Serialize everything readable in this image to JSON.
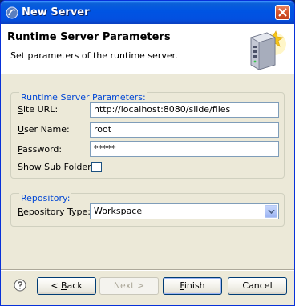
{
  "window": {
    "title": "New Server"
  },
  "header": {
    "title": "Runtime Server Parameters",
    "description": "Set parameters of the runtime server."
  },
  "params_group": {
    "legend": "Runtime Server Parameters:",
    "site_url": {
      "label_accel": "S",
      "label_rest": "ite URL:",
      "value": "http://localhost:8080/slide/files"
    },
    "user_name": {
      "label_pre": "",
      "label_accel": "U",
      "label_rest": "ser Name:",
      "value": "root"
    },
    "password": {
      "label_accel": "P",
      "label_rest": "assword:",
      "value": "*****"
    },
    "show_sub_folders": {
      "label_pre": "Sho",
      "label_accel": "w",
      "label_rest": " Sub Folders",
      "checked": false
    }
  },
  "repository_group": {
    "legend": "Repository:",
    "repo_type": {
      "label_accel": "R",
      "label_rest": "epository Type:",
      "value": "Workspace"
    }
  },
  "buttons": {
    "back_pre": "< ",
    "back_accel": "B",
    "back_rest": "ack",
    "next": "Next >",
    "finish_accel": "F",
    "finish_rest": "inish",
    "cancel": "Cancel"
  },
  "colors": {
    "accent": "#0046d5",
    "titlebar": "#0054e3",
    "dialog_bg": "#ece9d8"
  }
}
